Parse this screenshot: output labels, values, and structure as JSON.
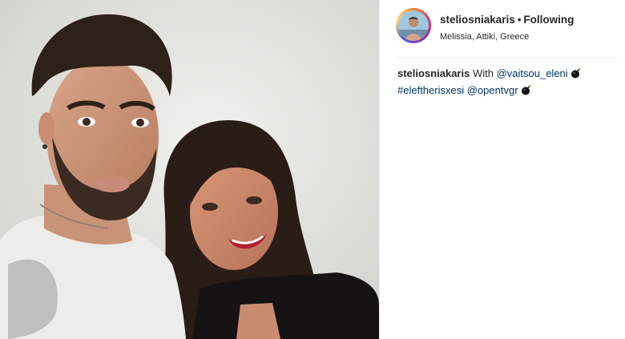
{
  "post": {
    "username": "steliosniakaris",
    "separator": "•",
    "follow_status": "Following",
    "location": "Melissia, Attiki, Greece",
    "caption": {
      "username": "steliosniakaris",
      "text": "With",
      "mention_1": "@vaitsou_eleni",
      "hashtag": "#eleftherisxesi",
      "mention_2": "@opentvgr",
      "emoji": "black bomb emoji"
    }
  },
  "icons": {
    "avatar": "user-avatar",
    "emoji_1": "bomb-icon",
    "emoji_2": "bomb-icon"
  },
  "colors": {
    "link": "#003569",
    "text": "#262626",
    "divider": "#efefef"
  }
}
